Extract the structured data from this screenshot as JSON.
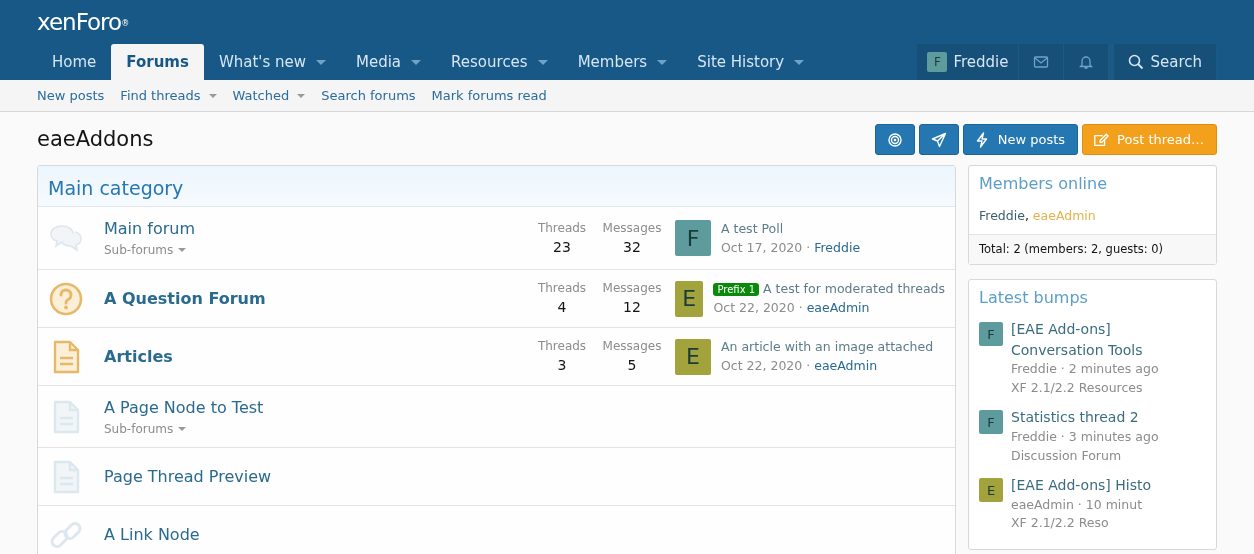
{
  "logo": {
    "text": "xenForo",
    "mark": "®"
  },
  "nav_tabs": [
    {
      "label": "Home",
      "selected": false,
      "has_menu": false
    },
    {
      "label": "Forums",
      "selected": true,
      "has_menu": false
    },
    {
      "label": "What's new",
      "selected": false,
      "has_menu": true
    },
    {
      "label": "Media",
      "selected": false,
      "has_menu": true
    },
    {
      "label": "Resources",
      "selected": false,
      "has_menu": true
    },
    {
      "label": "Members",
      "selected": false,
      "has_menu": true
    },
    {
      "label": "Site History",
      "selected": false,
      "has_menu": true
    }
  ],
  "user": {
    "initial": "F",
    "name": "Freddie",
    "color": "#5e9b9d"
  },
  "search": {
    "label": "Search"
  },
  "sub_nav": [
    {
      "label": "New posts",
      "has_menu": false
    },
    {
      "label": "Find threads",
      "has_menu": true
    },
    {
      "label": "Watched",
      "has_menu": true
    },
    {
      "label": "Search forums",
      "has_menu": false
    },
    {
      "label": "Mark forums read",
      "has_menu": false
    }
  ],
  "page_title": "eaeAddons",
  "actions": [
    {
      "kind": "watch"
    },
    {
      "kind": "send"
    },
    {
      "kind": "new",
      "label": "New posts"
    },
    {
      "kind": "post",
      "label": "Post thread…"
    }
  ],
  "category": {
    "title": "Main category",
    "nodes": [
      {
        "kind": "forum",
        "title": "Main forum",
        "unread": false,
        "sub_forums": "Sub-forums",
        "stats": [
          {
            "label": "Threads",
            "value": "23"
          },
          {
            "label": "Messages",
            "value": "32"
          }
        ],
        "last": {
          "initial": "F",
          "color": "#5e9b9d",
          "title": "A test Poll",
          "date": "Oct 17, 2020",
          "separator": "·",
          "user": "Freddie"
        }
      },
      {
        "kind": "question",
        "title": "A Question Forum",
        "unread": true,
        "stats": [
          {
            "label": "Threads",
            "value": "4"
          },
          {
            "label": "Messages",
            "value": "12"
          }
        ],
        "last": {
          "initial": "E",
          "color": "#a2a33c",
          "prefix": "Prefix 1",
          "title": "A test for moderated threads",
          "date": "Oct 22, 2020",
          "separator": "·",
          "user": "eaeAdmin"
        }
      },
      {
        "kind": "article",
        "title": "Articles",
        "unread": true,
        "stats": [
          {
            "label": "Threads",
            "value": "3"
          },
          {
            "label": "Messages",
            "value": "5"
          }
        ],
        "last": {
          "initial": "E",
          "color": "#a2a33c",
          "title": "An article with an image attached",
          "date": "Oct 22, 2020",
          "separator": "·",
          "user": "eaeAdmin"
        }
      },
      {
        "kind": "page",
        "title": "A Page Node to Test",
        "unread": false,
        "sub_forums": "Sub-forums"
      },
      {
        "kind": "page",
        "title": "Page Thread Preview",
        "unread": false
      },
      {
        "kind": "link",
        "title": "A Link Node",
        "unread": false
      }
    ]
  },
  "members_online": {
    "title": "Members online",
    "members": [
      {
        "name": "Freddie",
        "color": "#3c5f6e"
      },
      {
        "name": "eaeAdmin",
        "color": "#e6b04a"
      }
    ],
    "separator": ",",
    "total": "Total: 2 (members: 2, guests: 0)"
  },
  "latest_bumps": {
    "title": "Latest bumps",
    "items": [
      {
        "initial": "F",
        "color": "#5e9b9d",
        "title": "[EAE Add-ons] Conversation Tools",
        "meta": "Freddie · 2 minutes ago",
        "forum": "XF 2.1/2.2 Resources"
      },
      {
        "initial": "F",
        "color": "#5e9b9d",
        "title": "Statistics thread 2",
        "meta": "Freddie · 3 minutes ago",
        "forum": "Discussion Forum"
      },
      {
        "initial": "E",
        "color": "#a2a33c",
        "title": "[EAE Add-ons] Histo",
        "meta": "eaeAdmin · 10 minut",
        "forum": "XF 2.1/2.2 Reso"
      }
    ]
  }
}
